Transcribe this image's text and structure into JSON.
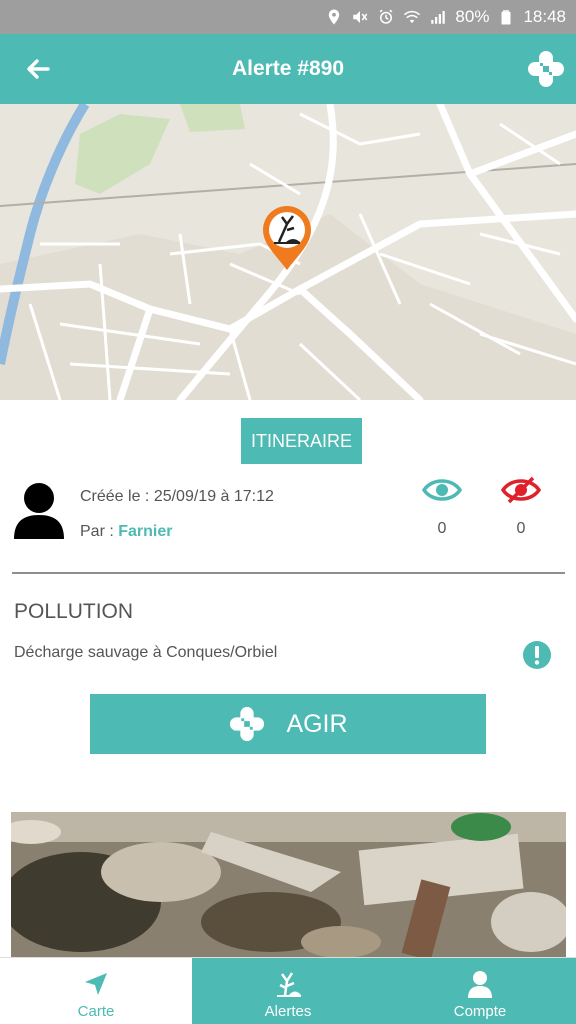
{
  "status_bar": {
    "battery": "80%",
    "time": "18:48",
    "icons": [
      "location-icon",
      "mute-icon",
      "alarm-icon",
      "wifi-icon",
      "signal-icon",
      "battery-icon"
    ]
  },
  "header": {
    "title": "Alerte #890",
    "back_icon": "arrow-left-icon",
    "action_icon": "plus-cross-icon"
  },
  "map": {
    "marker_icon": "pollution-tree-marker-icon",
    "marker_color": "#f07a1e"
  },
  "itinerary": {
    "label": "ITINERAIRE"
  },
  "author": {
    "created_label": "Créée le : 25/09/19 à 17:12",
    "by_label": "Par : ",
    "name": "Farnier"
  },
  "stats": {
    "seen_count": "0",
    "unseen_count": "0",
    "seen_color": "#4dbab3",
    "unseen_color": "#e0212b"
  },
  "alert": {
    "category": "POLLUTION",
    "description": "Décharge sauvage à Conques/Orbiel",
    "info_icon": "exclamation-circle-icon"
  },
  "action": {
    "label": "AGIR"
  },
  "bottom_nav": {
    "items": [
      {
        "label": "Carte",
        "icon": "navigation-arrow-icon",
        "active": true
      },
      {
        "label": "Alertes",
        "icon": "tree-alert-icon",
        "active": false
      },
      {
        "label": "Compte",
        "icon": "user-icon",
        "active": false
      }
    ]
  },
  "colors": {
    "primary": "#4dbab3",
    "status_bar": "#9e9e9e",
    "text": "#555555"
  }
}
